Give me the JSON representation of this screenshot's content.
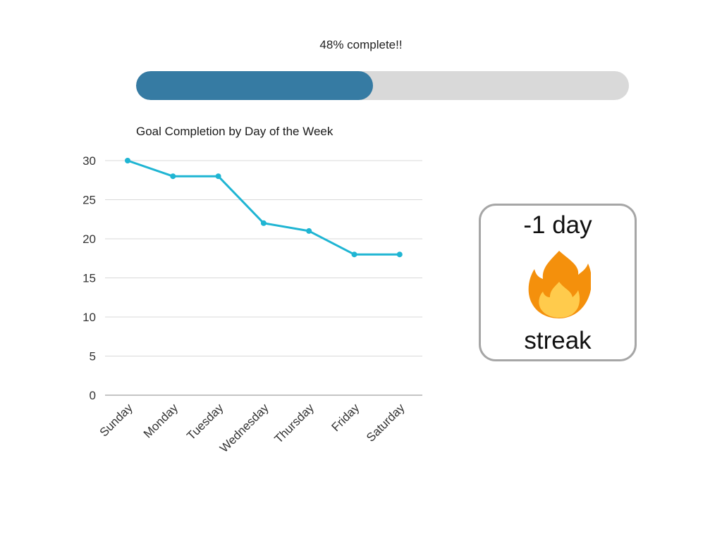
{
  "progress": {
    "label": "48% complete!!",
    "fraction": 0.48,
    "fill_color": "#367ba3",
    "track_color": "#d9d9d9"
  },
  "streak": {
    "value": "-1 day",
    "label": "streak",
    "icon": "fire-icon"
  },
  "chart_data": {
    "type": "line",
    "title": "Goal Completion by Day of the Week",
    "xlabel": "",
    "ylabel": "",
    "categories": [
      "Sunday",
      "Monday",
      "Tuesday",
      "Wednesday",
      "Thursday",
      "Friday",
      "Saturday"
    ],
    "values": [
      30,
      28,
      28,
      22,
      21,
      18,
      18
    ],
    "ylim": [
      0,
      30
    ],
    "yticks": [
      0,
      5,
      10,
      15,
      20,
      25,
      30
    ],
    "grid": true,
    "legend": "none",
    "line_color": "#1fb5d3"
  }
}
